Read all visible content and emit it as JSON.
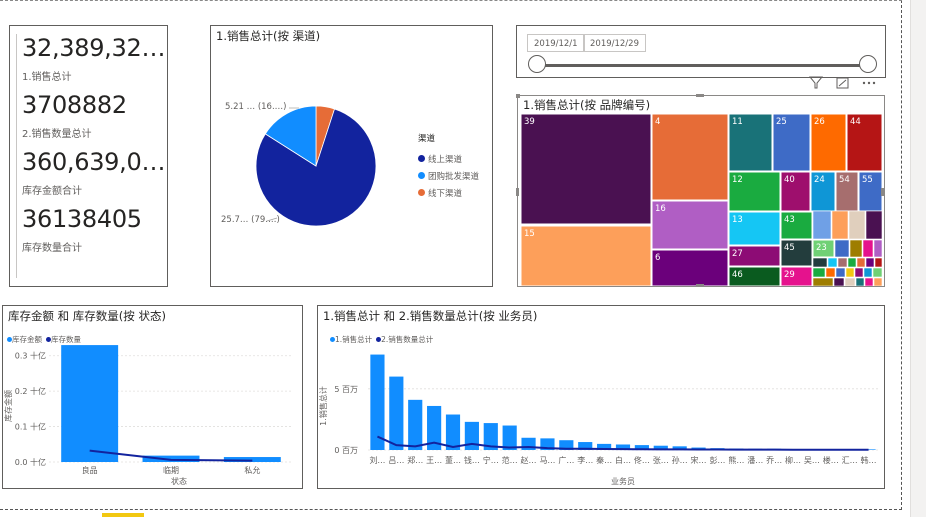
{
  "colors": {
    "series_light": "#118dff",
    "series_dark": "#12239e",
    "orange": "#e66c37"
  },
  "cards": [
    {
      "value": "32,389,32…",
      "label": "1.销售总计"
    },
    {
      "value": "3708882",
      "label": "2.销售数量总计"
    },
    {
      "value": "360,639,0…",
      "label": "库存金额合计"
    },
    {
      "value": "36138405",
      "label": "库存数量合计"
    }
  ],
  "pie": {
    "title": "1.销售总计(按 渠道)",
    "legend_title": "渠道",
    "label_top": "5.21 … (16.…)",
    "label_bottom": "25.7… (79.…)",
    "chart_data": {
      "type": "pie",
      "categories": [
        "线上渠道",
        "团购批发渠道",
        "线下渠道"
      ],
      "values": [
        79,
        16,
        5
      ],
      "colors": [
        "#12239e",
        "#118dff",
        "#e66c37"
      ]
    }
  },
  "slicer": {
    "start": "2019/12/1",
    "end": "2019/12/29"
  },
  "visual_header_icons": [
    "filter-icon",
    "focus-mode-icon",
    "more-options-icon"
  ],
  "treemap": {
    "title": "1.销售总计(按 品牌编号)",
    "labels": [
      "39",
      "15",
      "4",
      "16",
      "6",
      "11",
      "25",
      "26",
      "44",
      "12",
      "40",
      "24",
      "54",
      "55",
      "13",
      "43",
      "27",
      "45",
      "23",
      "46",
      "29"
    ]
  },
  "combo_left": {
    "title": "库存金额 和 库存数量(按 状态)",
    "legend": [
      "库存金额",
      "库存数量"
    ],
    "ylabel": "库存金额",
    "xlabel": "状态",
    "yticks": [
      "0.0 十亿",
      "0.1 十亿",
      "0.2 十亿",
      "0.3 十亿"
    ],
    "chart_data": {
      "type": "bar",
      "categories": [
        "良品",
        "临期",
        "私允"
      ],
      "series": [
        {
          "name": "库存金额",
          "values": [
            0.33,
            0.018,
            0.014
          ]
        },
        {
          "name": "库存数量",
          "values": [
            0.032,
            0.006,
            0.004
          ]
        }
      ],
      "ylim": [
        0,
        0.35
      ]
    }
  },
  "combo_right": {
    "title": "1.销售总计 和 2.销售数量总计(按 业务员)",
    "legend": [
      "1.销售总计",
      "2.销售数量总计"
    ],
    "ylabel": "1.销售总计",
    "xlabel": "业务员",
    "yticks": [
      "0 百万",
      "5 百万"
    ],
    "chart_data": {
      "type": "bar",
      "categories": [
        "刘…",
        "吕…",
        "郑…",
        "王…",
        "董…",
        "钱…",
        "宁…",
        "范…",
        "赵…",
        "马…",
        "广…",
        "李…",
        "秦…",
        "白…",
        "佟…",
        "张…",
        "孙…",
        "宋…",
        "彭…",
        "熊…",
        "潘…",
        "乔…",
        "柳…",
        "吴…",
        "楼…",
        "汇…",
        "韩…"
      ],
      "series": [
        {
          "name": "1.销售总计",
          "values": [
            7.8,
            6.0,
            4.1,
            3.6,
            2.9,
            2.3,
            2.2,
            2.0,
            1.0,
            0.95,
            0.8,
            0.65,
            0.5,
            0.45,
            0.4,
            0.35,
            0.3,
            0.2,
            0.15,
            0.12,
            0.1,
            0.1,
            0.08,
            0.07,
            0.06,
            0.05,
            0.05
          ]
        },
        {
          "name": "2.销售数量总计",
          "values": [
            1.1,
            0.4,
            0.3,
            0.6,
            0.25,
            0.5,
            0.3,
            0.2,
            0.25,
            0.15,
            0.1,
            0.1,
            0.08,
            0.07,
            0.06,
            0.05,
            0.05,
            0.04,
            0.04,
            0.03,
            0.03,
            0.03,
            0.02,
            0.02,
            0.02,
            0.02,
            0.02
          ]
        }
      ],
      "ylim": [
        0,
        8.5
      ]
    }
  }
}
